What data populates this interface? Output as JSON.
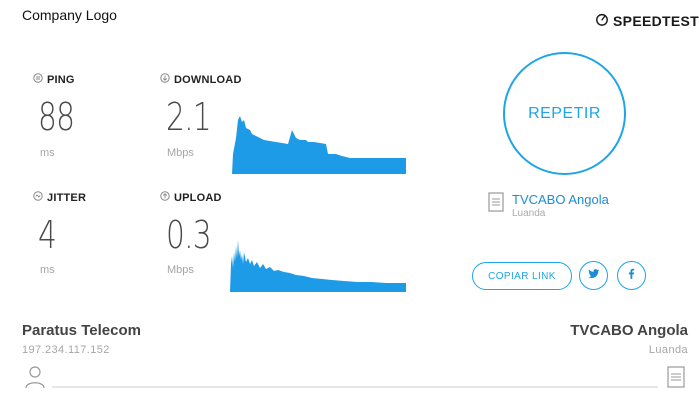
{
  "header": {
    "logo_text": "Company Logo",
    "brand_text": "SPEEDTEST"
  },
  "metrics": {
    "ping": {
      "label": "PING",
      "value": "88",
      "unit": "ms"
    },
    "download": {
      "label": "DOWNLOAD",
      "value": "2.1",
      "unit": "Mbps"
    },
    "jitter": {
      "label": "JITTER",
      "value": "4",
      "unit": "ms"
    },
    "upload": {
      "label": "UPLOAD",
      "value": "0.3",
      "unit": "Mbps"
    }
  },
  "actions": {
    "repeat_label": "REPETIR",
    "copy_link_label": "COPIAR LINK",
    "twitter_icon": "twitter-icon",
    "facebook_icon": "facebook-icon"
  },
  "server": {
    "name": "TVCABO Angola",
    "city": "Luanda"
  },
  "footer": {
    "isp_name": "Paratus Telecom",
    "isp_ip": "197.234.117.152",
    "server_name": "TVCABO Angola",
    "server_city": "Luanda"
  },
  "colors": {
    "accent": "#1ea5e6",
    "graph": "#1e9be6",
    "label": "#222222",
    "muted": "#a6a6a6"
  }
}
